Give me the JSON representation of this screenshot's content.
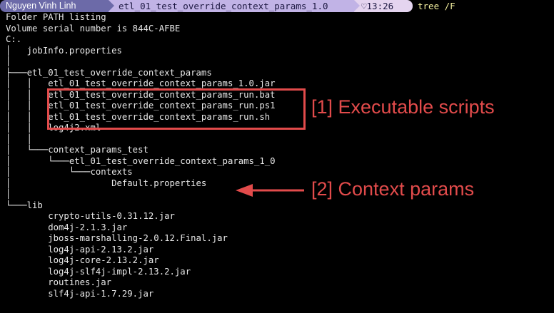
{
  "prompt": {
    "user": "Nguyen Vinh Linh",
    "directory": "etl_01_test_override_context_params_1.0",
    "time": "13:26",
    "heart_glyph": "♡",
    "command": "tree /F"
  },
  "output": {
    "lines": [
      "Folder PATH listing",
      "Volume serial number is 844C-AFBE",
      "C:.",
      "│   jobInfo.properties",
      "│",
      "├───etl_01_test_override_context_params",
      "│   │   etl_01_test_override_context_params_1.0.jar",
      "│   │   etl_01_test_override_context_params_run.bat",
      "│   │   etl_01_test_override_context_params_run.ps1",
      "│   │   etl_01_test_override_context_params_run.sh",
      "│   │   log4j2.xml",
      "│   │",
      "│   └───context_params_test",
      "│       └───etl_01_test_override_context_params_1_0",
      "│           └───contexts",
      "│                   Default.properties",
      "│",
      "└───lib",
      "        crypto-utils-0.31.12.jar",
      "        dom4j-2.1.3.jar",
      "        jboss-marshalling-2.0.12.Final.jar",
      "        log4j-api-2.13.2.jar",
      "        log4j-core-2.13.2.jar",
      "        log4j-slf4j-impl-2.13.2.jar",
      "        routines.jar",
      "        slf4j-api-1.7.29.jar"
    ]
  },
  "annotations": {
    "executable_scripts": "[1] Executable scripts",
    "context_params": "[2] Context params",
    "color": "#e24b4b"
  }
}
